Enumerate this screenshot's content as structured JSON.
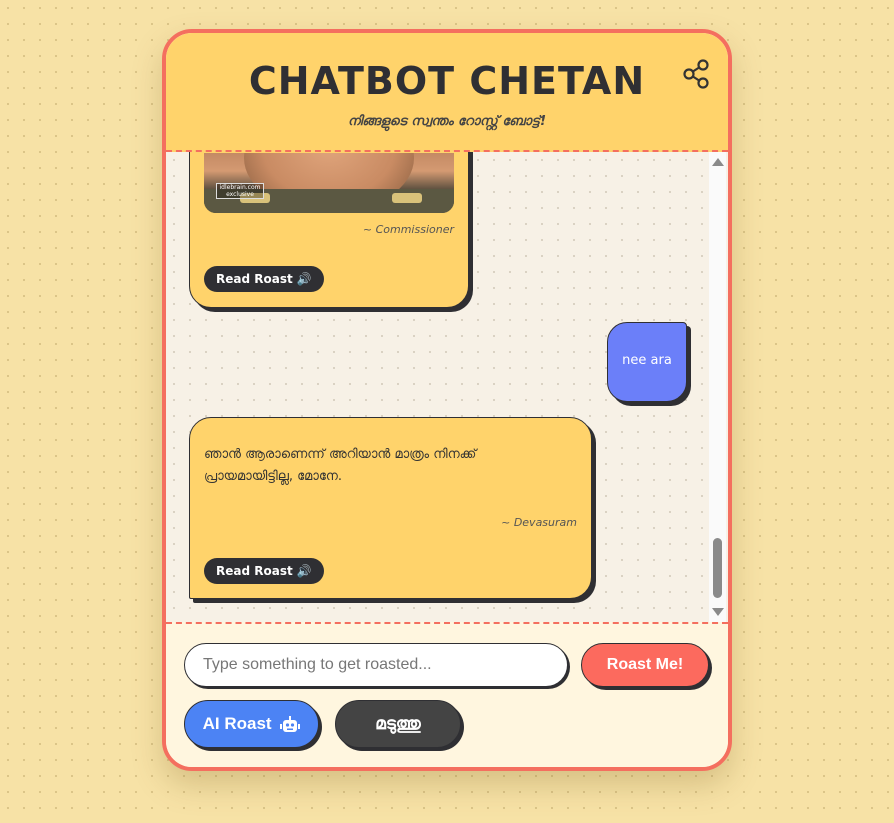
{
  "header": {
    "title": "CHATBOT CHETAN",
    "subtitle": "നിങ്ങളുടെ സ്വന്തം റോസ്റ്റ് ബോട്ട്!",
    "share_icon": "share-icon"
  },
  "messages": [
    {
      "role": "bot",
      "image": "commissioner-still",
      "image_watermark": "idlebrain.com exclusive",
      "source": "~ Commissioner",
      "read_label": "Read Roast"
    },
    {
      "role": "user",
      "text": "nee ara"
    },
    {
      "role": "bot",
      "text": "ഞാൻ ആരാണെന്ന് അറിയാൻ മാത്രം നിനക്ക് പ്രായമായിട്ടില്ല, മോനേ.",
      "source": "~ Devasuram",
      "read_label": "Read Roast"
    }
  ],
  "composer": {
    "placeholder": "Type something to get roasted...",
    "value": "",
    "roast_label": "Roast Me!",
    "ai_label": "AI Roast",
    "ai_icon": "robot-icon",
    "madathu_label": "മടുത്തു"
  },
  "colors": {
    "accent": "#f46f5f",
    "header_bg": "#ffd36b",
    "user_bubble": "#6b7ff9",
    "ai_button": "#4c83f4",
    "dark": "#2f2f33"
  }
}
